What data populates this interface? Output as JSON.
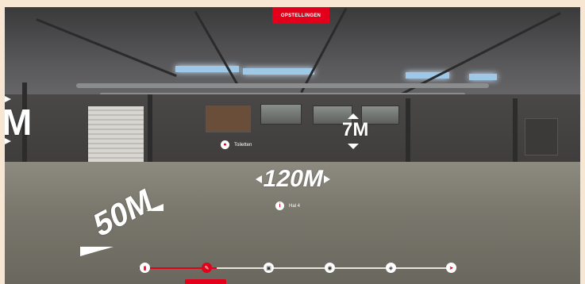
{
  "top_button": {
    "label": "OPSTELLINGEN"
  },
  "hotspots": [
    {
      "label": "Toiletten",
      "icon": "toilet-icon"
    },
    {
      "label": "Hal 4",
      "icon": "info-icon"
    }
  ],
  "dimensions": {
    "height": "7M",
    "length": "120M",
    "width": "50M",
    "edge_fragment": "M"
  },
  "timeline": {
    "progress": 0.25,
    "steps": [
      {
        "icon": "door-icon",
        "state": "done"
      },
      {
        "icon": "pencil-icon",
        "state": "active"
      },
      {
        "icon": "book-icon",
        "state": "todo"
      },
      {
        "icon": "food-icon",
        "state": "todo"
      },
      {
        "icon": "car-icon",
        "state": "todo"
      },
      {
        "icon": "send-icon",
        "state": "todo"
      }
    ]
  },
  "colors": {
    "accent": "#e3001b",
    "page_bg": "#f6e6d2"
  }
}
